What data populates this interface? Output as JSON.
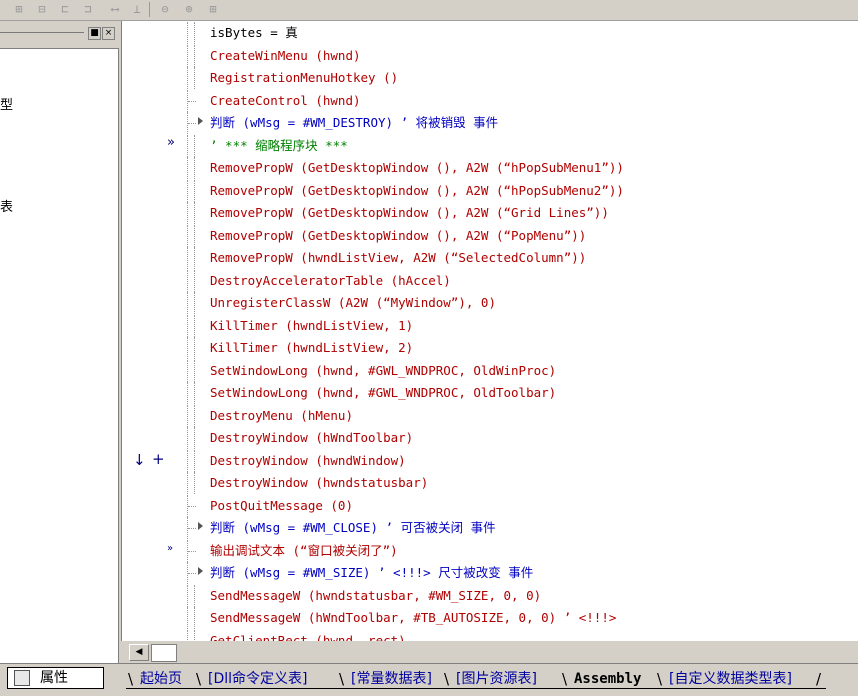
{
  "toolbar": {
    "icons": [
      "align-left-icon",
      "align-center-icon",
      "align-right-icon",
      "align-justify-icon",
      "hspace-icon",
      "vspace-icon",
      "width-icon",
      "height-icon",
      "size-icon"
    ]
  },
  "left_panel": {
    "fragments": [
      "型",
      "表"
    ],
    "properties_tab": "属性"
  },
  "code_lines": [
    {
      "text": "isBytes = 真",
      "color": "black",
      "indent": 2
    },
    {
      "text": "CreateWinMenu (hwnd)",
      "color": "red",
      "indent": 2
    },
    {
      "text": "RegistrationMenuHotkey ()",
      "color": "red",
      "indent": 2
    },
    {
      "text": "CreateControl (hwnd)",
      "color": "red",
      "indent": 1
    },
    {
      "text": "判断 (wMsg = #WM_DESTROY) ’ 将被销毁 事件",
      "color": "blue",
      "indent": 1,
      "branch": true
    },
    {
      "text": "’ *** 缩略程序块 ***",
      "color": "green",
      "indent": 2
    },
    {
      "text": "RemovePropW (GetDesktopWindow (), A2W (“hPopSubMenu1”))",
      "color": "red",
      "indent": 2
    },
    {
      "text": "RemovePropW (GetDesktopWindow (), A2W (“hPopSubMenu2”))",
      "color": "red",
      "indent": 2
    },
    {
      "text": "RemovePropW (GetDesktopWindow (), A2W (“Grid Lines”))",
      "color": "red",
      "indent": 2
    },
    {
      "text": "RemovePropW (GetDesktopWindow (), A2W (“PopMenu”))",
      "color": "red",
      "indent": 2
    },
    {
      "text": "RemovePropW (hwndListView, A2W (“SelectedColumn”))",
      "color": "red",
      "indent": 2
    },
    {
      "text": "DestroyAcceleratorTable (hAccel)",
      "color": "red",
      "indent": 2
    },
    {
      "text": "UnregisterClassW (A2W (“MyWindow”), 0)",
      "color": "red",
      "indent": 2
    },
    {
      "text": "KillTimer (hwndListView, 1)",
      "color": "red",
      "indent": 2
    },
    {
      "text": "KillTimer (hwndListView, 2)",
      "color": "red",
      "indent": 2
    },
    {
      "text": "SetWindowLong (hwnd, #GWL_WNDPROC, OldWinProc)",
      "color": "red",
      "indent": 2
    },
    {
      "text": "SetWindowLong (hwnd, #GWL_WNDPROC, OldToolbar)",
      "color": "red",
      "indent": 2
    },
    {
      "text": "DestroyMenu (hMenu)",
      "color": "red",
      "indent": 2
    },
    {
      "text": "DestroyWindow (hWndToolbar)",
      "color": "red",
      "indent": 2
    },
    {
      "text": "DestroyWindow (hwndWindow)",
      "color": "red",
      "indent": 2
    },
    {
      "text": "DestroyWindow (hwndstatusbar)",
      "color": "red",
      "indent": 2
    },
    {
      "text": "PostQuitMessage (0)",
      "color": "red",
      "indent": 1
    },
    {
      "text": "判断 (wMsg = #WM_CLOSE) ’ 可否被关闭 事件",
      "color": "blue",
      "indent": 1,
      "branch": true
    },
    {
      "text": "输出调试文本 (“窗口被关闭了”)",
      "color": "red",
      "indent": 1
    },
    {
      "text": "判断 (wMsg = #WM_SIZE) ’ <!!!> 尺寸被改变 事件",
      "color": "blue",
      "indent": 1,
      "branch": true
    },
    {
      "text": "SendMessageW (hwndstatusbar, #WM_SIZE, 0, 0)",
      "color": "red",
      "indent": 2
    },
    {
      "text": "SendMessageW (hWndToolbar, #TB_AUTOSIZE, 0, 0) ’ <!!!>",
      "color": "red",
      "indent": 2
    },
    {
      "text": "GetClientRect (hwnd, rect)",
      "color": "red",
      "indent": 2
    }
  ],
  "gutter": {
    "collapse_marker": "»",
    "run_marker": "»",
    "arrow": "↓",
    "plus": "+"
  },
  "bottom_tabs": [
    {
      "label": "起始页",
      "active": false
    },
    {
      "label": "[Dll命令定义表]",
      "active": false
    },
    {
      "label": "[常量数据表]",
      "active": false
    },
    {
      "label": "[图片资源表]",
      "active": false
    },
    {
      "label": "Assembly",
      "active": true
    },
    {
      "label": "[自定义数据类型表]",
      "active": false
    }
  ],
  "colors": {
    "black": "#000000",
    "red": "#b00000",
    "blue": "#0000c0",
    "green": "#008000"
  }
}
